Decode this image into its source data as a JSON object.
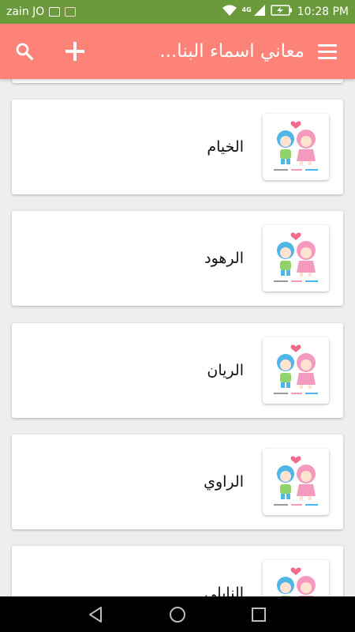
{
  "status_bar": {
    "carrier": "zain JO",
    "network": "4G",
    "time": "10:28 PM",
    "icons": [
      "android-icon",
      "mail-icon",
      "wifi-icon",
      "signal-icon",
      "battery-charging-icon"
    ]
  },
  "app_bar": {
    "title": "معاني اسماء البنا...",
    "icons": [
      "search-icon",
      "add-icon",
      "menu-icon"
    ],
    "background": "#fd8277"
  },
  "list": {
    "items": [
      {
        "name": "الخيام"
      },
      {
        "name": "الرهود"
      },
      {
        "name": "الريان"
      },
      {
        "name": "الراوي"
      },
      {
        "name": "النابلي"
      }
    ],
    "thumbnail_icon": "kids-couple-icon"
  },
  "nav_bar": {
    "icons": [
      "back-triangle-icon",
      "home-circle-icon",
      "recents-square-icon"
    ]
  }
}
